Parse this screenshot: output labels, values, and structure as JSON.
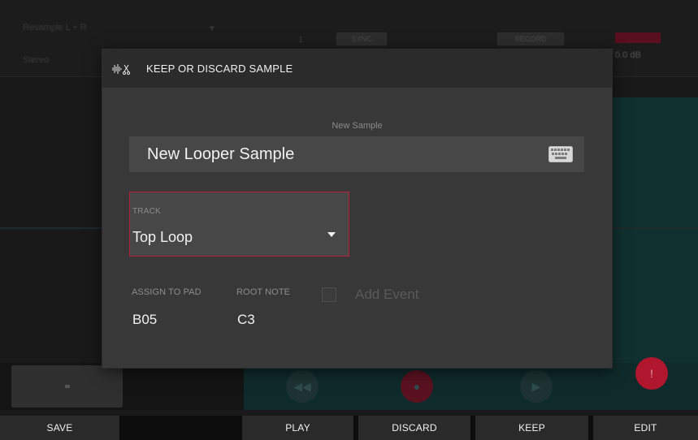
{
  "background": {
    "sample_source": "Resample L + R",
    "mode": "Stereo",
    "threshold_value": "1",
    "sync_chip": "SYNC",
    "record_label": "RECORD",
    "level_readout": "0.0 dB",
    "pad_label": "+"
  },
  "modal": {
    "title": "KEEP OR DISCARD SAMPLE",
    "icon": "waveform-scissors-icon",
    "name_caption": "New Sample",
    "name_value": "New Looper Sample",
    "keyboard_icon": "keyboard-icon",
    "track": {
      "caption": "TRACK",
      "value": "Top Loop",
      "accent": "#b3203e"
    },
    "assign_to_pad": {
      "caption": "ASSIGN TO PAD",
      "value": "B05"
    },
    "root_note": {
      "caption": "ROOT NOTE",
      "value": "C3"
    },
    "add_event": {
      "label": "Add Event",
      "checked": false
    }
  },
  "softkeys": {
    "save": "SAVE",
    "play": "PLAY",
    "discard": "DISCARD",
    "keep": "KEEP",
    "edit": "EDIT"
  }
}
